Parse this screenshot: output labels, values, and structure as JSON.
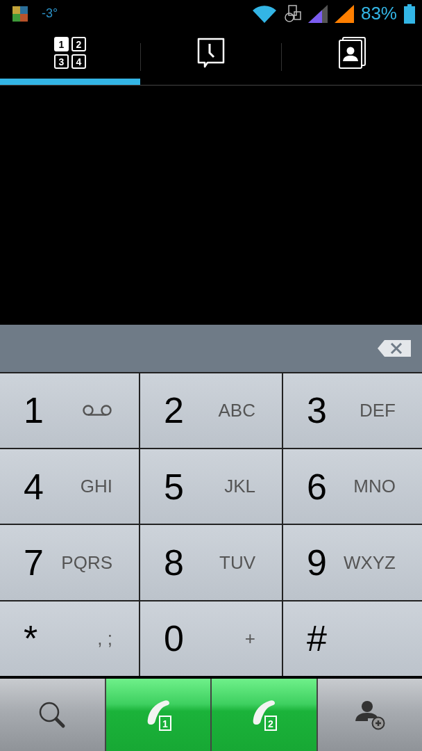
{
  "status_bar": {
    "temperature": "-3°",
    "battery": "83%"
  },
  "tabs": [
    {
      "kind": "dialpad",
      "icon_digits": [
        "1",
        "2",
        "3",
        "4"
      ],
      "selected": true
    },
    {
      "kind": "history",
      "selected": false
    },
    {
      "kind": "contacts",
      "selected": false
    }
  ],
  "keypad": [
    {
      "digit": "1",
      "kind": "voicemail"
    },
    {
      "digit": "2",
      "letters": "ABC",
      "kind": "letters"
    },
    {
      "digit": "3",
      "letters": "DEF",
      "kind": "letters"
    },
    {
      "digit": "4",
      "letters": "GHI",
      "kind": "letters"
    },
    {
      "digit": "5",
      "letters": "JKL",
      "kind": "letters"
    },
    {
      "digit": "6",
      "letters": "MNO",
      "kind": "letters"
    },
    {
      "digit": "7",
      "letters": "PQRS",
      "kind": "letters"
    },
    {
      "digit": "8",
      "letters": "TUV",
      "kind": "letters"
    },
    {
      "digit": "9",
      "letters": "WXYZ",
      "kind": "letters"
    },
    {
      "digit": "*",
      "letters": ", ;",
      "kind": "letters"
    },
    {
      "digit": "0",
      "letters": "+",
      "kind": "letters"
    },
    {
      "digit": "#",
      "kind": "plain"
    }
  ],
  "bottom_bar": [
    {
      "kind": "search"
    },
    {
      "kind": "call",
      "sim": "1"
    },
    {
      "kind": "call",
      "sim": "2"
    },
    {
      "kind": "add_contact"
    }
  ]
}
